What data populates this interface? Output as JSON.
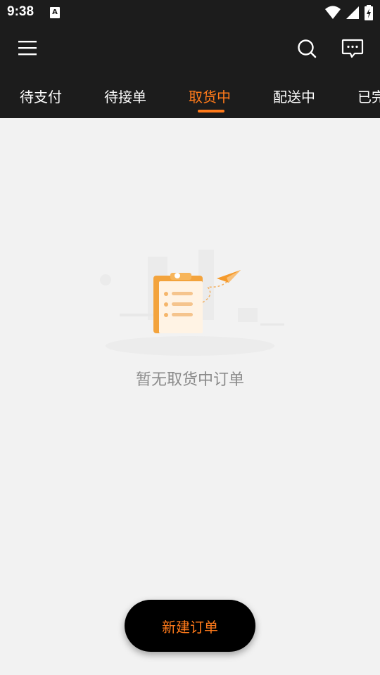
{
  "status_bar": {
    "time": "9:38",
    "notification_icon_letter": "A",
    "icons": [
      "wifi-icon",
      "signal-icon",
      "battery-icon"
    ]
  },
  "header": {
    "icons": [
      "menu-icon",
      "search-icon",
      "chat-icon"
    ]
  },
  "tabs": [
    {
      "label": "待支付",
      "active": false
    },
    {
      "label": "待接单",
      "active": false
    },
    {
      "label": "取货中",
      "active": true
    },
    {
      "label": "配送中",
      "active": false
    },
    {
      "label": "已完",
      "active": false
    }
  ],
  "empty_state": {
    "message": "暂无取货中订单"
  },
  "new_order_button": {
    "label": "新建订单"
  },
  "colors": {
    "accent": "#ff7a1a",
    "header_bg": "#1c1c1c",
    "page_bg": "#f2f2f2"
  }
}
